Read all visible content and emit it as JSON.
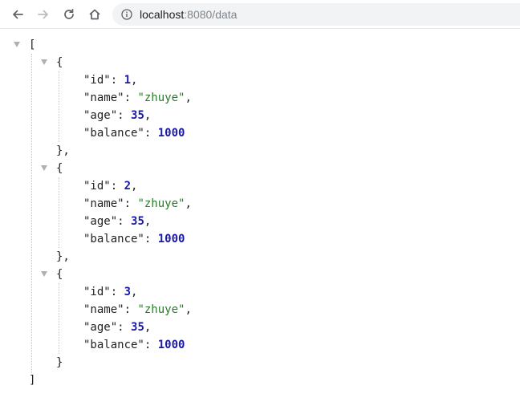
{
  "browser": {
    "url_host": "localhost",
    "url_rest": ":8080/data",
    "icons": [
      "back-arrow-icon",
      "forward-arrow-icon",
      "reload-icon",
      "home-icon",
      "info-icon"
    ]
  },
  "json_view": {
    "open_bracket": "[",
    "close_bracket": "]",
    "open_brace": "{",
    "close_brace": "}",
    "close_brace_comma": "},",
    "records": [
      {
        "fields": [
          {
            "key": "\"id\"",
            "value": "1",
            "type": "number",
            "comma": ","
          },
          {
            "key": "\"name\"",
            "value": "\"zhuye\"",
            "type": "string",
            "comma": ","
          },
          {
            "key": "\"age\"",
            "value": "35",
            "type": "number",
            "comma": ","
          },
          {
            "key": "\"balance\"",
            "value": "1000",
            "type": "number",
            "comma": ""
          }
        ]
      },
      {
        "fields": [
          {
            "key": "\"id\"",
            "value": "2",
            "type": "number",
            "comma": ","
          },
          {
            "key": "\"name\"",
            "value": "\"zhuye\"",
            "type": "string",
            "comma": ","
          },
          {
            "key": "\"age\"",
            "value": "35",
            "type": "number",
            "comma": ","
          },
          {
            "key": "\"balance\"",
            "value": "1000",
            "type": "number",
            "comma": ""
          }
        ]
      },
      {
        "fields": [
          {
            "key": "\"id\"",
            "value": "3",
            "type": "number",
            "comma": ","
          },
          {
            "key": "\"name\"",
            "value": "\"zhuye\"",
            "type": "string",
            "comma": ","
          },
          {
            "key": "\"age\"",
            "value": "35",
            "type": "number",
            "comma": ","
          },
          {
            "key": "\"balance\"",
            "value": "1000",
            "type": "number",
            "comma": ""
          }
        ]
      }
    ]
  },
  "colors": {
    "number": "#1a1aa6",
    "string": "#2a7a2a",
    "key": "#202124"
  }
}
